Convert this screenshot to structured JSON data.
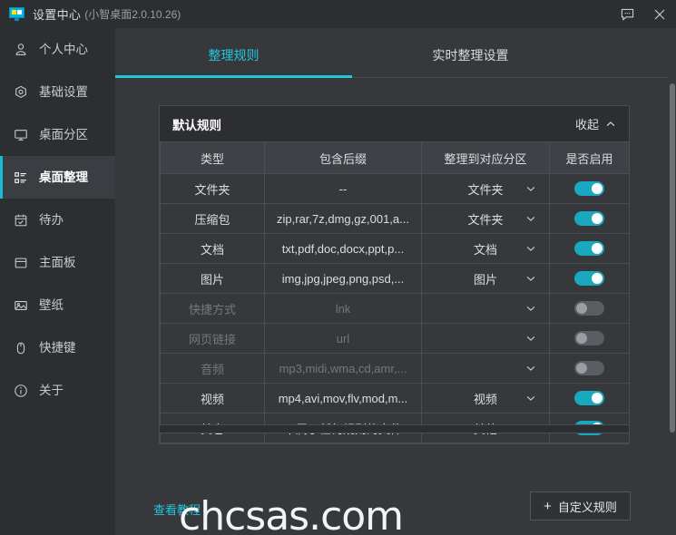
{
  "window": {
    "title": "设置中心",
    "version": "(小智桌面2.0.10.26)",
    "app_icon": "monitor-icon",
    "feedback_icon": "speech-bubble-icon",
    "close_icon": "close-icon"
  },
  "sidebar": {
    "items": [
      {
        "label": "个人中心",
        "icon": "person-icon",
        "active": false
      },
      {
        "label": "基础设置",
        "icon": "hexagon-gear-icon",
        "active": false
      },
      {
        "label": "桌面分区",
        "icon": "monitor-icon",
        "active": false
      },
      {
        "label": "桌面整理",
        "icon": "list-icon",
        "active": true
      },
      {
        "label": "待办",
        "icon": "calendar-check-icon",
        "active": false
      },
      {
        "label": "主面板",
        "icon": "panel-icon",
        "active": false
      },
      {
        "label": "壁纸",
        "icon": "image-icon",
        "active": false
      },
      {
        "label": "快捷键",
        "icon": "mouse-icon",
        "active": false
      },
      {
        "label": "关于",
        "icon": "info-icon",
        "active": false
      }
    ]
  },
  "tabs": [
    {
      "label": "整理规则",
      "active": true
    },
    {
      "label": "实时整理设置",
      "active": false
    }
  ],
  "card": {
    "title": "默认规则",
    "collapse_label": "收起",
    "collapse_icon": "chevron-up-icon",
    "columns": [
      "类型",
      "包含后缀",
      "整理到对应分区",
      "是否启用"
    ],
    "rows": [
      {
        "type": "文件夹",
        "suffix": "--",
        "partition": "文件夹",
        "enabled": true
      },
      {
        "type": "压缩包",
        "suffix": "zip,rar,7z,dmg,gz,001,a...",
        "partition": "文件夹",
        "enabled": true
      },
      {
        "type": "文档",
        "suffix": "txt,pdf,doc,docx,ppt,p...",
        "partition": "文档",
        "enabled": true
      },
      {
        "type": "图片",
        "suffix": "img,jpg,jpeg,png,psd,...",
        "partition": "图片",
        "enabled": true
      },
      {
        "type": "快捷方式",
        "suffix": "lnk",
        "partition": "",
        "enabled": false
      },
      {
        "type": "网页链接",
        "suffix": "url",
        "partition": "",
        "enabled": false
      },
      {
        "type": "音频",
        "suffix": "mp3,midi,wma,cd,amr,...",
        "partition": "",
        "enabled": false
      },
      {
        "type": "视频",
        "suffix": "mp4,avi,mov,flv,mod,m...",
        "partition": "视频",
        "enabled": true
      },
      {
        "type": "其它",
        "suffix": "不属于任何规则的文件",
        "partition": "其他",
        "enabled": true
      }
    ]
  },
  "footer": {
    "tutorial_label": "查看教程",
    "watermark": "chcsas.com",
    "custom_rule_label": "自定义规则",
    "custom_rule_icon": "plus-icon"
  },
  "colors": {
    "accent": "#22c7dd",
    "toggle_on": "#19a8bd",
    "toggle_off": "#5a5d62",
    "window_bg": "#36383c",
    "sidebar_bg": "#2c2e31"
  }
}
